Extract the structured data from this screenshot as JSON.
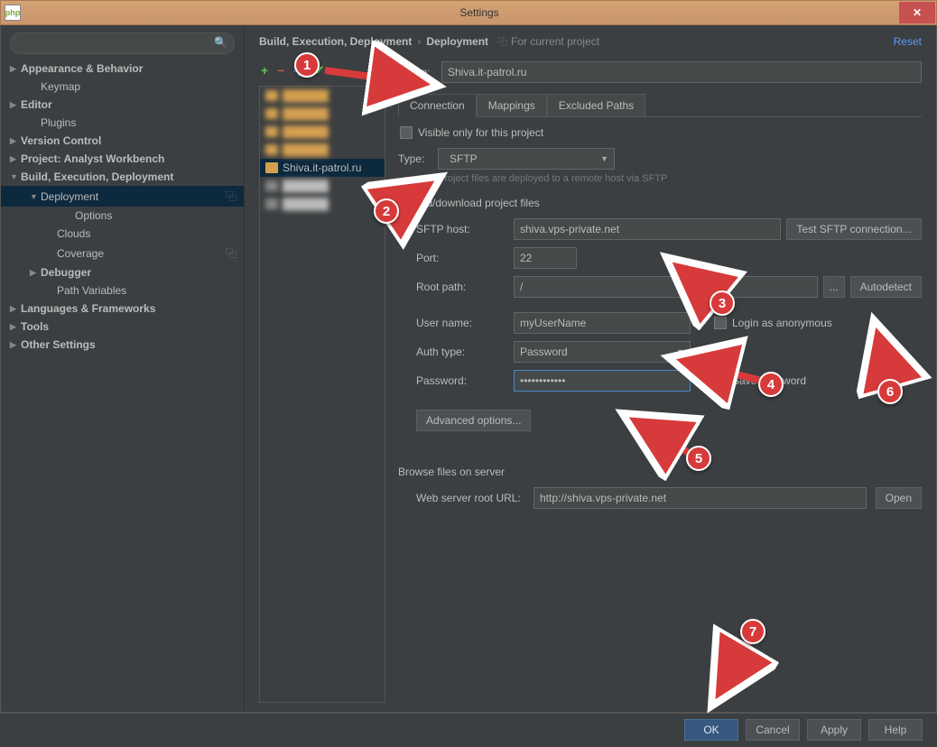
{
  "window": {
    "title": "Settings",
    "app_icon_text": "php"
  },
  "reset_label": "Reset",
  "breadcrumb": {
    "part1": "Build, Execution, Deployment",
    "part2": "Deployment",
    "for_project": "For current project"
  },
  "search": {
    "placeholder": ""
  },
  "tree": [
    {
      "label": "Appearance & Behavior",
      "bold": true,
      "arrow": "▶",
      "ind": 0
    },
    {
      "label": "Keymap",
      "ind": 1
    },
    {
      "label": "Editor",
      "bold": true,
      "arrow": "▶",
      "ind": 0
    },
    {
      "label": "Plugins",
      "ind": 1
    },
    {
      "label": "Version Control",
      "bold": true,
      "arrow": "▶",
      "ind": 0
    },
    {
      "label": "Project: Analyst Workbench",
      "bold": true,
      "arrow": "▶",
      "ind": 0
    },
    {
      "label": "Build, Execution, Deployment",
      "bold": true,
      "arrow": "▼",
      "ind": 0
    },
    {
      "label": "Deployment",
      "arrow": "▼",
      "ind": 1,
      "selected": true,
      "tail": "⿻"
    },
    {
      "label": "Options",
      "ind": 3
    },
    {
      "label": "Clouds",
      "ind": 2
    },
    {
      "label": "Coverage",
      "ind": 2,
      "tail": "⿻"
    },
    {
      "label": "Debugger",
      "bold": true,
      "arrow": "▶",
      "ind": 1
    },
    {
      "label": "Path Variables",
      "ind": 2
    },
    {
      "label": "Languages & Frameworks",
      "bold": true,
      "arrow": "▶",
      "ind": 0
    },
    {
      "label": "Tools",
      "bold": true,
      "arrow": "▶",
      "ind": 0
    },
    {
      "label": "Other Settings",
      "bold": true,
      "arrow": "▶",
      "ind": 0
    }
  ],
  "servers": {
    "blurred_count": 6,
    "selected": "Shiva.it-patrol.ru"
  },
  "form": {
    "name_label": "Name:",
    "name_value": "Shiva.it-patrol.ru",
    "tabs": [
      "Connection",
      "Mappings",
      "Excluded Paths"
    ],
    "active_tab": 0,
    "visible_only_label": "Visible only for this project",
    "visible_only_checked": false,
    "type_label": "Type:",
    "type_value": "SFTP",
    "type_hint": "Project files are deployed to a remote host via SFTP",
    "upload_group": "Upload/download project files",
    "sftp_host_label": "SFTP host:",
    "sftp_host_value": "shiva.vps-private.net",
    "test_btn": "Test SFTP connection...",
    "port_label": "Port:",
    "port_value": "22",
    "root_label": "Root path:",
    "root_value": "/",
    "autodetect_btn": "Autodetect",
    "user_label": "User name:",
    "user_value": "myUserName",
    "anon_label": "Login as anonymous",
    "auth_label": "Auth type:",
    "auth_value": "Password",
    "pass_label": "Password:",
    "pass_value": "••••••••••••",
    "save_pass_label": "Save password",
    "advanced_btn": "Advanced options...",
    "browse_group": "Browse files on server",
    "web_url_label": "Web server root URL:",
    "web_url_value": "http://shiva.vps-private.net",
    "open_btn": "Open"
  },
  "footer": {
    "ok": "OK",
    "cancel": "Cancel",
    "apply": "Apply",
    "help": "Help"
  },
  "annotations": {
    "1": "1",
    "2": "2",
    "3": "3",
    "4": "4",
    "5": "5",
    "6": "6",
    "7": "7"
  }
}
